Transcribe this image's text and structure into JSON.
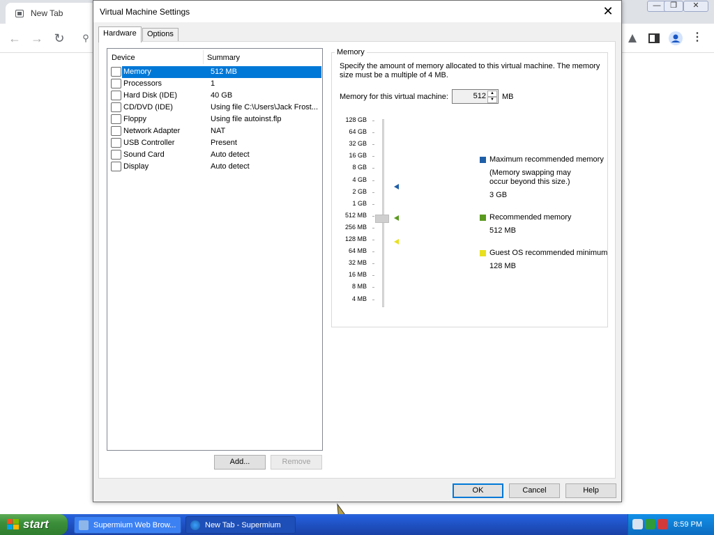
{
  "browser": {
    "tab_title": "New Tab"
  },
  "dialog": {
    "title": "Virtual Machine Settings",
    "tabs": [
      {
        "label": "Hardware",
        "active": true
      },
      {
        "label": "Options",
        "active": false
      }
    ],
    "device_list": {
      "col_device": "Device",
      "col_summary": "Summary",
      "rows": [
        {
          "device": "Memory",
          "summary": "512 MB",
          "icon": "memory-icon",
          "selected": true
        },
        {
          "device": "Processors",
          "summary": "1",
          "icon": "processor-icon",
          "selected": false
        },
        {
          "device": "Hard Disk (IDE)",
          "summary": "40 GB",
          "icon": "hard-disk-icon",
          "selected": false
        },
        {
          "device": "CD/DVD (IDE)",
          "summary": "Using file C:\\Users\\Jack Frost...",
          "icon": "cd-dvd-icon",
          "selected": false
        },
        {
          "device": "Floppy",
          "summary": "Using file autoinst.flp",
          "icon": "floppy-icon",
          "selected": false
        },
        {
          "device": "Network Adapter",
          "summary": "NAT",
          "icon": "network-adapter-icon",
          "selected": false
        },
        {
          "device": "USB Controller",
          "summary": "Present",
          "icon": "usb-icon",
          "selected": false
        },
        {
          "device": "Sound Card",
          "summary": "Auto detect",
          "icon": "sound-card-icon",
          "selected": false
        },
        {
          "device": "Display",
          "summary": "Auto detect",
          "icon": "display-icon",
          "selected": false
        }
      ]
    },
    "add_button": "Add...",
    "remove_button": "Remove",
    "memory": {
      "group_title": "Memory",
      "description": "Specify the amount of memory allocated to this virtual machine. The memory size must be a multiple of 4 MB.",
      "field_label": "Memory for this virtual machine:",
      "value": "512",
      "unit": "MB",
      "scale": [
        "128 GB",
        "64 GB",
        "32 GB",
        "16 GB",
        "8 GB",
        "4 GB",
        "2 GB",
        "1 GB",
        "512 MB",
        "256 MB",
        "128 MB",
        "64 MB",
        "32 MB",
        "16 MB",
        "8 MB",
        "4 MB"
      ],
      "slider_value": "512 MB",
      "legend": [
        {
          "label": "Maximum recommended memory",
          "note": "(Memory swapping may\noccur beyond this size.)",
          "value": "3 GB",
          "color": "#1f5fa8"
        },
        {
          "label": "Recommended memory",
          "note": "",
          "value": "512 MB",
          "color": "#5a9a1f"
        },
        {
          "label": "Guest OS recommended minimum",
          "note": "",
          "value": "128 MB",
          "color": "#e8e020"
        }
      ]
    },
    "buttons": {
      "ok": "OK",
      "cancel": "Cancel",
      "help": "Help"
    }
  },
  "taskbar": {
    "start_label": "start",
    "tasks": [
      {
        "label": "Supermium Web Brow...",
        "active": false
      },
      {
        "label": "New Tab - Supermium",
        "active": true
      }
    ],
    "clock": "8:59 PM"
  }
}
